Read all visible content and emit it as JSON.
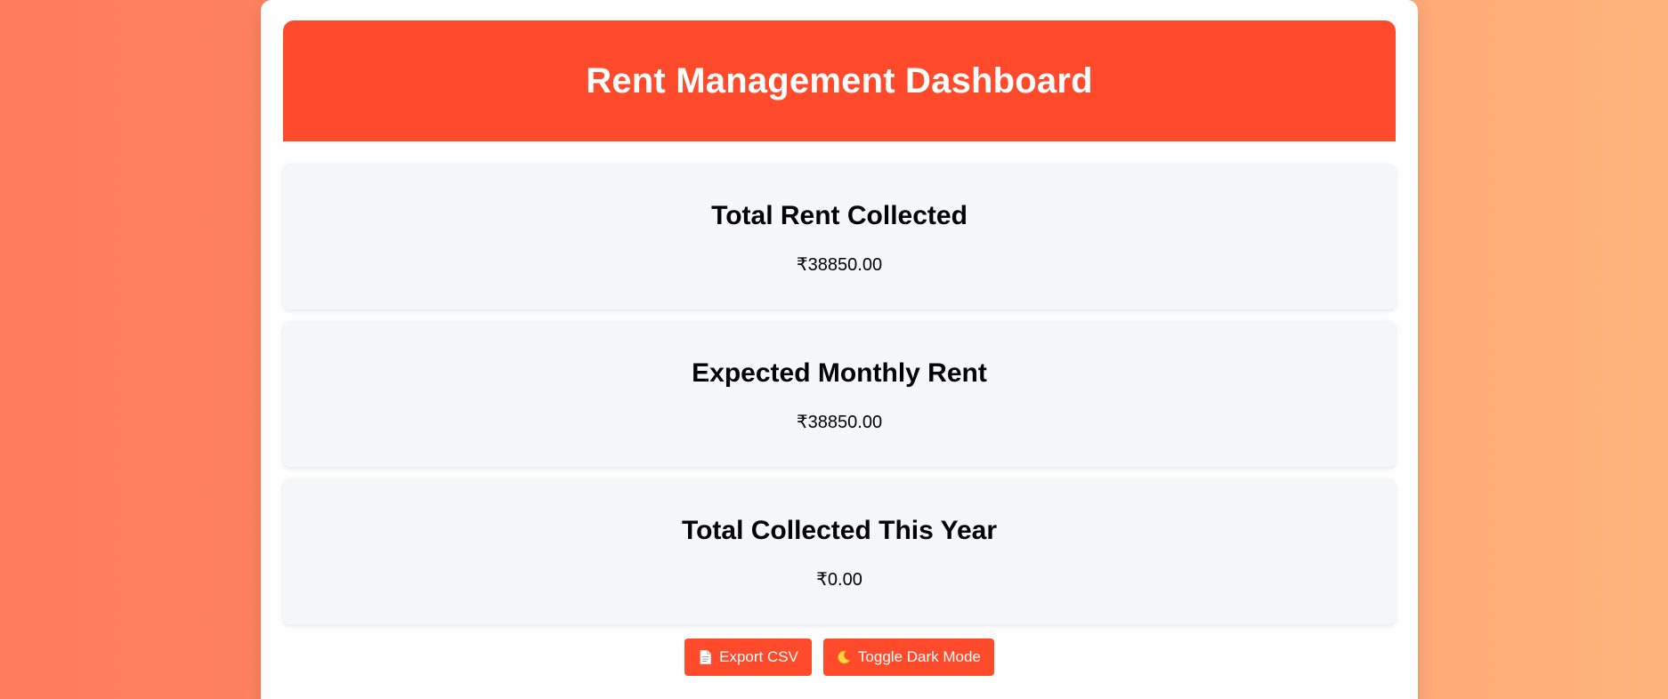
{
  "header": {
    "title": "Rent Management Dashboard"
  },
  "cards": [
    {
      "title": "Total Rent Collected",
      "value": "₹38850.00"
    },
    {
      "title": "Expected Monthly Rent",
      "value": "₹38850.00"
    },
    {
      "title": "Total Collected This Year",
      "value": "₹0.00"
    }
  ],
  "actions": {
    "export_label": "Export CSV",
    "export_icon": "document-icon",
    "toggle_label": "Toggle Dark Mode",
    "toggle_icon": "moon-icon"
  },
  "colors": {
    "accent": "#ff4b2b",
    "card_background": "#f6f7f9"
  }
}
